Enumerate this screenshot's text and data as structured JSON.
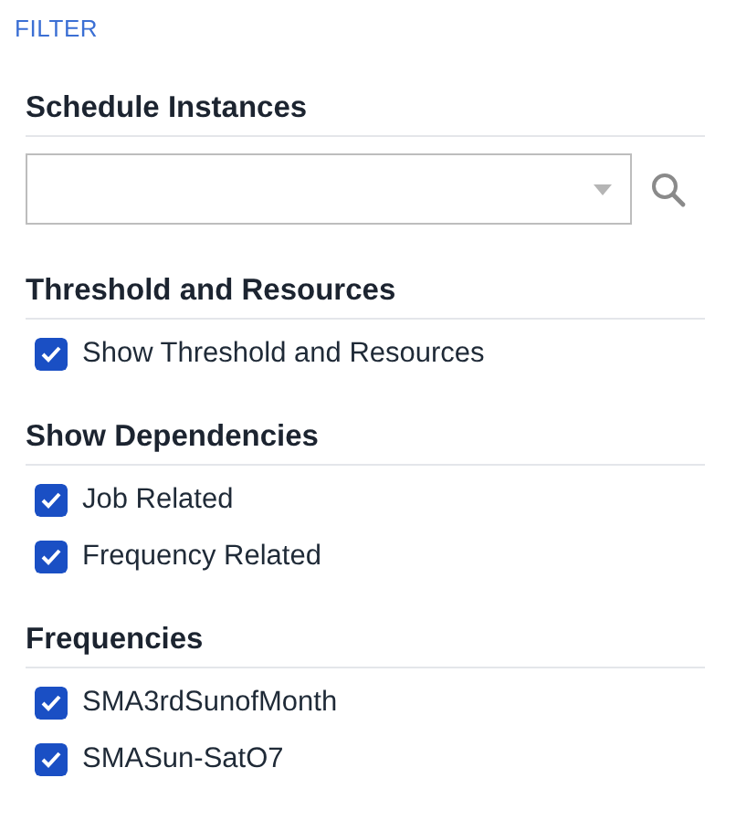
{
  "title": "FILTER",
  "sections": [
    {
      "heading": "Schedule Instances",
      "kind": "select"
    },
    {
      "heading": "Threshold and Resources",
      "kind": "checklist",
      "items": [
        {
          "label": "Show Threshold and Resources",
          "checked": true
        }
      ]
    },
    {
      "heading": "Show Dependencies",
      "kind": "checklist",
      "items": [
        {
          "label": "Job Related",
          "checked": true
        },
        {
          "label": "Frequency Related",
          "checked": true
        }
      ]
    },
    {
      "heading": "Frequencies",
      "kind": "checklist",
      "items": [
        {
          "label": "SMA3rdSunofMonth",
          "checked": true
        },
        {
          "label": "SMASun-SatO7",
          "checked": true
        }
      ]
    }
  ]
}
